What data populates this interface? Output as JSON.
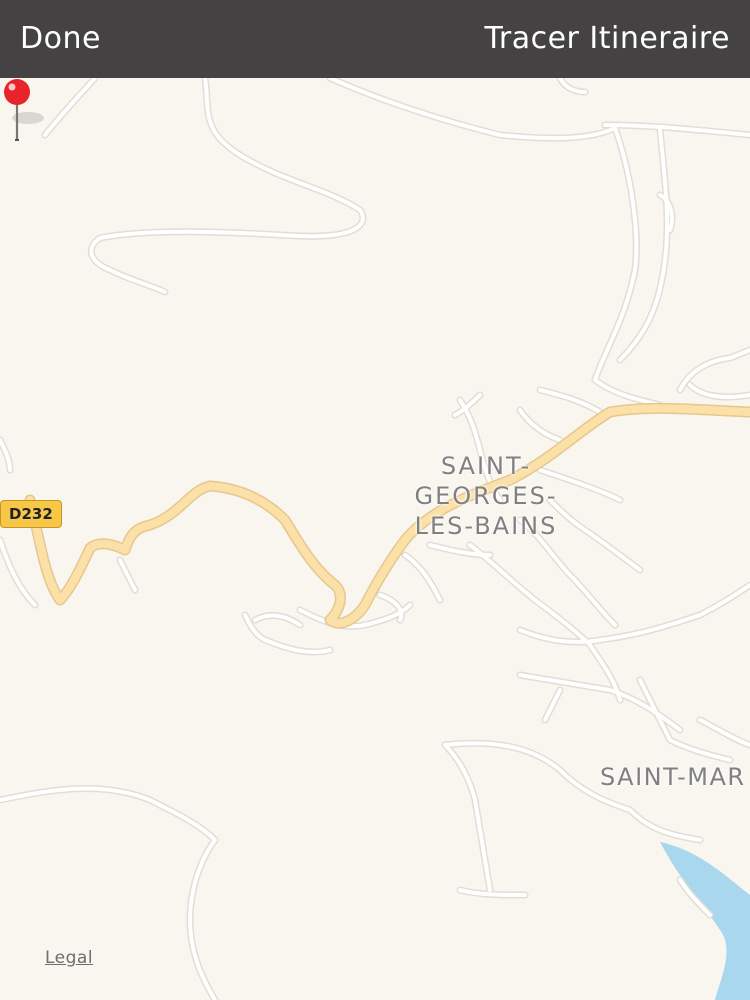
{
  "navbar": {
    "done_label": "Done",
    "route_label": "Tracer Itineraire",
    "background": "#444242"
  },
  "map": {
    "places": {
      "saint_georges": [
        "SAINT-",
        "GEORGES-",
        "LES-BAINS"
      ],
      "saint_mar": "SAINT-MAR"
    },
    "road_shield": "D232",
    "legal_label": "Legal",
    "colors": {
      "land": "#f9f5ef",
      "minor_road": "#ffffff",
      "road_casing": "#e2ddd5",
      "main_road": "#fbe0a8",
      "water": "#a9d8ee",
      "pin": "#e8232a"
    }
  }
}
